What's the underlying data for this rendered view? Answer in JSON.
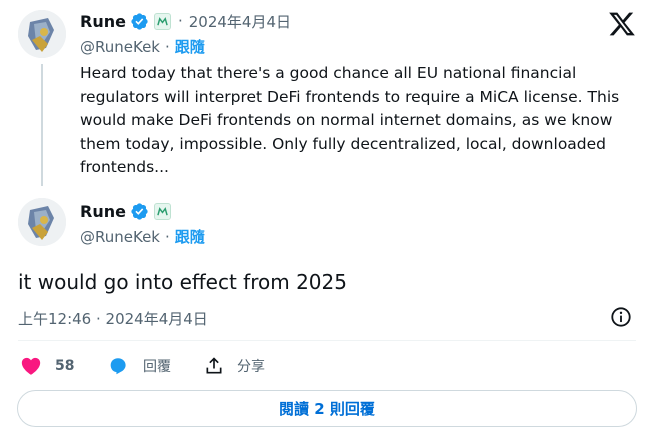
{
  "quoted_tweet": {
    "author_name": "Rune",
    "separator": "·",
    "date": "2024年4月4日",
    "handle": "@RuneKek",
    "follow_label": "跟隨",
    "text_lines": [
      "Heard today that there's a good chance all EU national financial",
      "regulators will interpret DeFi frontends to require a MiCA license. This",
      "would make DeFi frontends on normal internet domains, as we know",
      "them today, impossible. Only fully decentralized, local, downloaded",
      "frontends..."
    ]
  },
  "main_tweet": {
    "author_name": "Rune",
    "handle": "@RuneKek",
    "follow_label": "跟隨",
    "text": "it would go into effect from 2025",
    "timestamp": "上午12:46 · 2024年4月4日"
  },
  "actions": {
    "like_count": "58",
    "reply_label": "回覆",
    "share_label": "分享"
  },
  "read_replies_label": "閱讀 2 則回覆",
  "colors": {
    "like": "#f91880",
    "reply": "#1d9bf0",
    "verified": "#1d9bf0",
    "link": "#1d9bf0"
  },
  "icons": [
    "x-logo-icon",
    "verified-badge-icon",
    "org-badge-icon",
    "heart-icon",
    "reply-icon",
    "share-icon",
    "info-icon"
  ]
}
